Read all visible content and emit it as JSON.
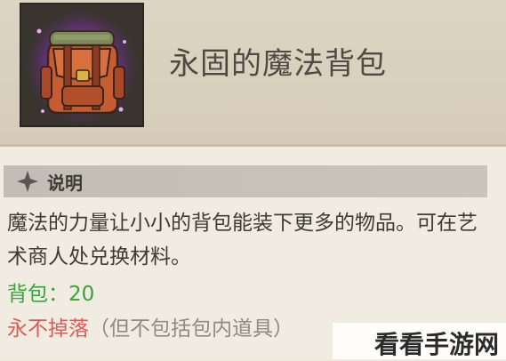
{
  "item": {
    "name": "永固的魔法背包",
    "icon": "magic-backpack-icon"
  },
  "section": {
    "label": "说明",
    "icon": "diamond-star-icon"
  },
  "description": "魔法的力量让小小的背包能装下更多的物品。可在艺术商人处兑换材料。",
  "stat": {
    "text": "背包：20"
  },
  "binding": {
    "red_text": "永不掉落",
    "note": "（但不包括包内道具）"
  },
  "watermark": "看看手游网",
  "colors": {
    "stat_green": "#3ba33b",
    "binding_red": "#dc5b55",
    "glow_purple": "#b43cff"
  }
}
